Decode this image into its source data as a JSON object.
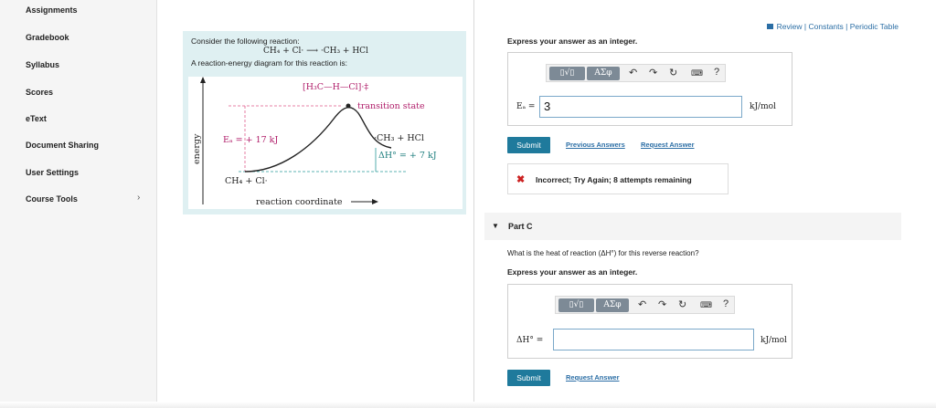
{
  "sidebar": {
    "items": [
      {
        "label": "Assignments"
      },
      {
        "label": "Gradebook"
      },
      {
        "label": "Syllabus"
      },
      {
        "label": "Scores"
      },
      {
        "label": "eText"
      },
      {
        "label": "Document Sharing"
      },
      {
        "label": "User Settings"
      },
      {
        "label": "Course Tools",
        "chevron": "›"
      }
    ]
  },
  "problem": {
    "intro": "Consider the following reaction:",
    "equation": "CH₄ + Cl· ⟶ ·CH₃ + HCl",
    "diagram_intro": "A reaction-energy diagram for this reaction is:",
    "diagram": {
      "transition_complex": "[H₃C—H—Cl]·‡",
      "transition_label": "transition state",
      "ea_label": "Eₐ = + 17 kJ",
      "products_label": "·CH₃ + HCl",
      "dh_label": "ΔH° = + 7 kJ",
      "reactants_label": "CH₄ + Cl·",
      "y_axis_label": "energy",
      "x_axis_label": "reaction coordinate"
    }
  },
  "header_links": {
    "review": "Review",
    "sep": "|",
    "constants": "Constants",
    "periodic_table": "Periodic Table"
  },
  "part_b": {
    "prompt": "Express your answer as an integer.",
    "toolbar": {
      "templates": "▯√▯",
      "symbols": "ΑΣφ",
      "help": "?"
    },
    "var_label": "Eₐ =",
    "answer_value": "3",
    "unit": "kJ/mol",
    "submit": "Submit",
    "previous_answers": "Previous Answers",
    "request_answer": "Request Answer",
    "feedback_icon": "✖",
    "feedback": "Incorrect; Try Again; 8 attempts remaining"
  },
  "part_c": {
    "title": "Part C",
    "question": "What is the heat of reaction (ΔH°) for this reverse reaction?",
    "prompt": "Express your answer as an integer.",
    "toolbar": {
      "templates": "▯√▯",
      "symbols": "ΑΣφ",
      "help": "?"
    },
    "var_label": "ΔH° =",
    "answer_value": "",
    "unit": "kJ/mol",
    "submit": "Submit",
    "request_answer": "Request Answer"
  },
  "icons": {
    "undo": "undo-icon",
    "redo": "redo-icon",
    "reset": "reset-icon",
    "keyboard": "keyboard-icon"
  }
}
